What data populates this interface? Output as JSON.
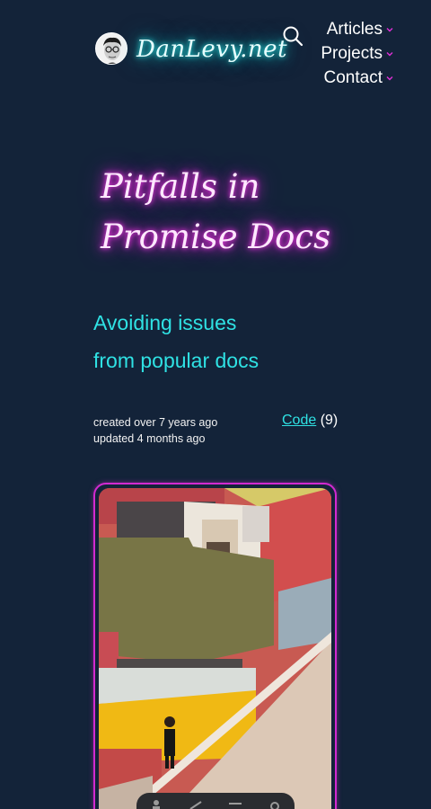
{
  "site": {
    "logo_text": "DanLevy.net"
  },
  "nav": {
    "items": [
      {
        "label": "Articles"
      },
      {
        "label": "Projects"
      },
      {
        "label": "Contact"
      }
    ]
  },
  "article": {
    "title_line1": "Pitfalls in",
    "title_line2": "Promise Docs",
    "subtitle_line1": "Avoiding issues",
    "subtitle_line2": "from popular docs",
    "created": "created over 7 years ago",
    "updated": "updated 4 months ago",
    "tag_label": "Code",
    "tag_count": "(9)"
  },
  "colors": {
    "background": "#132339",
    "accent_cyan": "#2fe2e4",
    "accent_magenta": "#d22ad0"
  },
  "icons": {
    "search": "search-icon",
    "chevron": "chevron-down-icon"
  }
}
